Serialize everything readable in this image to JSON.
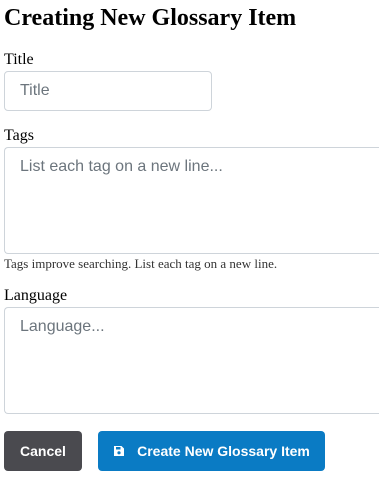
{
  "page": {
    "heading": "Creating New Glossary Item"
  },
  "form": {
    "title_label": "Title",
    "title_placeholder": "Title",
    "tags_label": "Tags",
    "tags_placeholder": "List each tag on a new line...",
    "tags_help": "Tags improve searching. List each tag on a new line.",
    "language_label": "Language",
    "language_placeholder": "Language..."
  },
  "actions": {
    "cancel_label": "Cancel",
    "create_label": "Create New Glossary Item",
    "create_icon": "save-icon"
  },
  "colors": {
    "cancel_bg": "#4a4a4f",
    "create_bg": "#0a7bc4"
  }
}
